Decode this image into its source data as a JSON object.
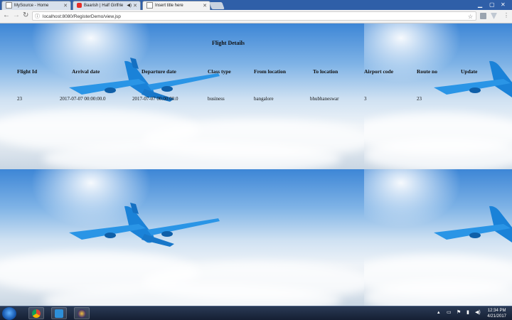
{
  "browser": {
    "tabs": [
      {
        "title": "MySource - Home",
        "active": false
      },
      {
        "title": "Baarish | Half Girlfrie",
        "active": false
      },
      {
        "title": "Insert title here",
        "active": true
      }
    ],
    "url": "localhost:8080/RegisterDemo/view.jsp"
  },
  "page": {
    "title": "Flight Details",
    "table": {
      "headers": [
        "Flight Id",
        "Arrival date",
        "Departure date",
        "Class type",
        "From location",
        "To location",
        "Airport code",
        "Route no",
        "Update"
      ],
      "rows": [
        [
          "23",
          "2017-07-07 00:00:00.0",
          "2017-07-07 00:00:00.0",
          "business",
          "bangalore",
          "bhubhaneswar",
          "3",
          "23",
          ""
        ]
      ]
    }
  },
  "taskbar": {
    "clock_time": "12:34 PM",
    "clock_date": "4/21/2017"
  },
  "colors": {
    "tabbar": "#2f5fa8",
    "sky_top": "#3d86d6",
    "plane": "#1d8de0"
  }
}
